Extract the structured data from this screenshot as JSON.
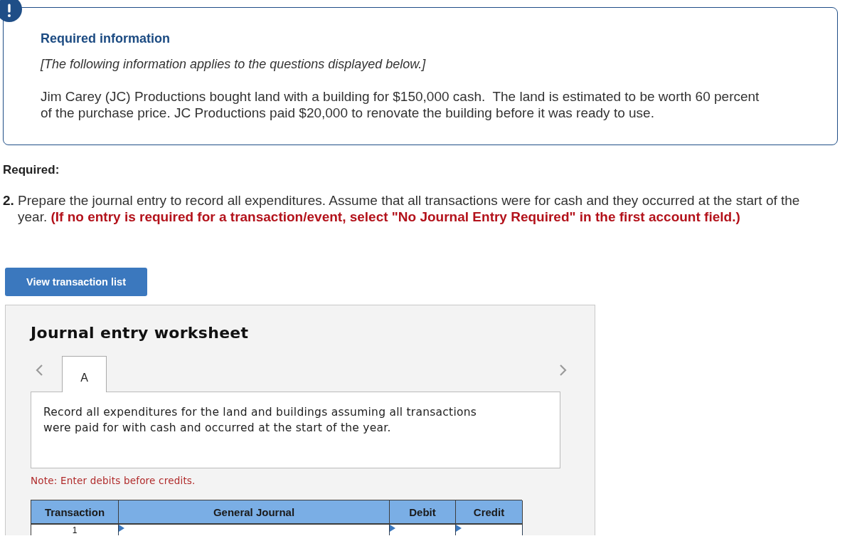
{
  "info_box": {
    "title": "Required information",
    "subtitle": "[The following information applies to the questions displayed below.]",
    "body": "Jim Carey (JC) Productions bought land with a building for $150,000 cash.  The land is estimated to be worth 60 percent of the purchase price. JC Productions paid $20,000 to renovate the building before it was ready to use."
  },
  "required": {
    "heading": "Required:",
    "number": "2.",
    "text": "Prepare the journal entry to record all expenditures. Assume that all transactions were for cash and they occurred at the start of the year. **(If no entry is required for a transaction/event, select \"No Journal Entry Required\" in the first account field.)**"
  },
  "button": {
    "label": "View transaction list"
  },
  "worksheet": {
    "title": "Journal entry worksheet",
    "tabs": [
      {
        "label": "A",
        "selected": true
      }
    ],
    "prompt": "Record all expenditures for the land and buildings assuming all transactions were paid for with cash and occurred at the start of the year.",
    "note": "Note: Enter debits before credits.",
    "table": {
      "columns": [
        "Transaction",
        "General Journal",
        "Debit",
        "Credit"
      ],
      "rows": [
        {
          "transaction": "1"
        }
      ]
    }
  }
}
